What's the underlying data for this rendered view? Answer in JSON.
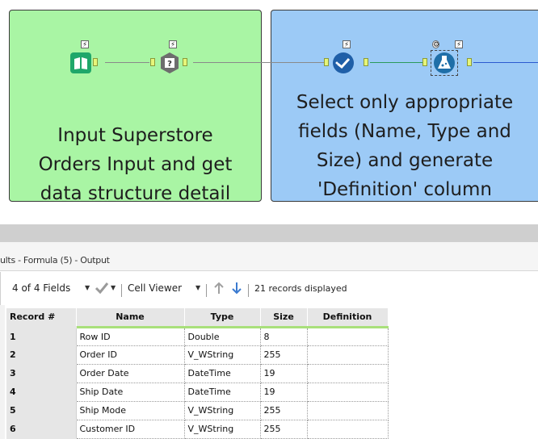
{
  "canvas": {
    "containers": [
      {
        "name": "container-input",
        "caption": [
          "Input Superstore",
          "Orders Input and get",
          "data structure detail"
        ],
        "color": "#a9f5a4"
      },
      {
        "name": "container-select",
        "caption": [
          "Select only appropriate",
          "fields (Name, Type and",
          "Size) and generate",
          "'Definition' column"
        ],
        "color": "#9ccaf6"
      }
    ]
  },
  "results": {
    "title": "ults - Formula (5) - Output",
    "toolbar": {
      "fields_label": "4 of 4 Fields",
      "viewer_label": "Cell Viewer",
      "records_label": "21 records displayed"
    },
    "columns": [
      "Record #",
      "Name",
      "Type",
      "Size",
      "Definition"
    ],
    "rows": [
      [
        "1",
        "Row ID",
        "Double",
        "8",
        ""
      ],
      [
        "2",
        "Order ID",
        "V_WString",
        "255",
        ""
      ],
      [
        "3",
        "Order Date",
        "DateTime",
        "19",
        ""
      ],
      [
        "4",
        "Ship Date",
        "DateTime",
        "19",
        ""
      ],
      [
        "5",
        "Ship Mode",
        "V_WString",
        "255",
        ""
      ],
      [
        "6",
        "Customer ID",
        "V_WString",
        "255",
        ""
      ]
    ]
  },
  "colors": {
    "accent_green": "#a8e07a",
    "tool_blue": "#1f5fa8",
    "tool_green": "#1fa76a",
    "tool_gray": "#6d6d6d",
    "tool_teal": "#1f6fa8"
  },
  "icons": [
    "book-input-icon",
    "field-info-icon",
    "select-check-icon",
    "formula-flask-icon",
    "checkmark-icon",
    "arrow-up-icon",
    "arrow-down-icon",
    "lightning-icon"
  ]
}
